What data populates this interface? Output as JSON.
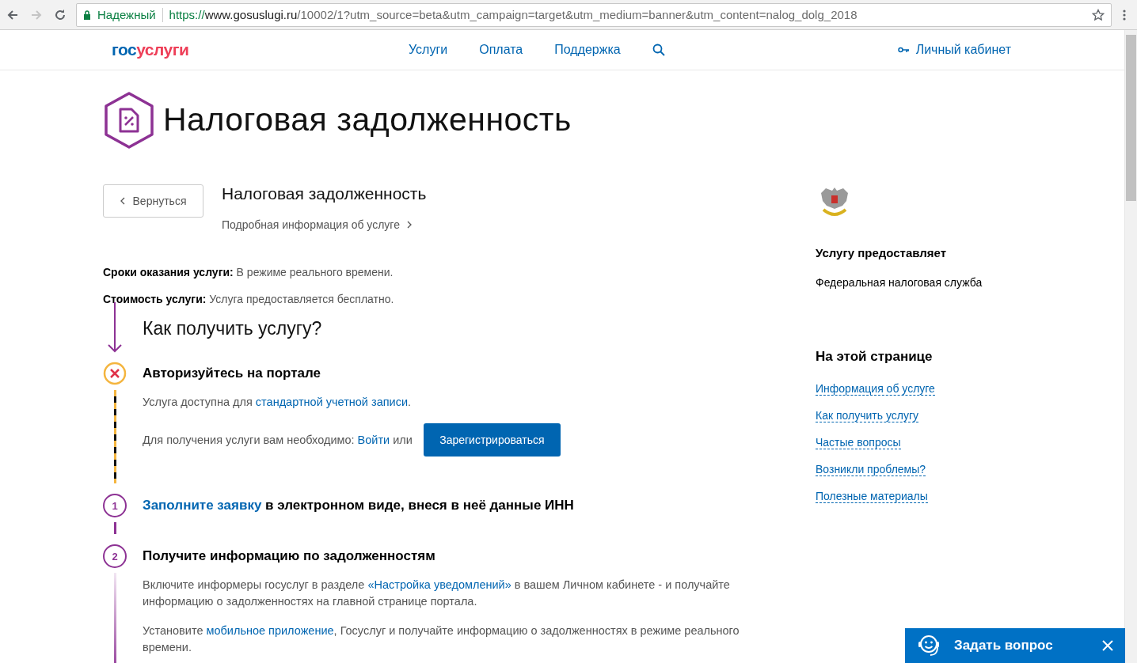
{
  "browser": {
    "security": "Надежный",
    "url": [
      {
        "kind": "scheme",
        "text": "https://"
      },
      {
        "kind": "host",
        "text": "www.gosuslugi.ru"
      },
      {
        "kind": "path",
        "text": "/10002/1?utm_source=beta&utm_campaign=target&utm_medium=banner&utm_content=nalog_dolg_2018"
      }
    ]
  },
  "header": {
    "logo": {
      "first": "гос",
      "second": "услуги"
    },
    "nav": [
      "Услуги",
      "Оплата",
      "Поддержка"
    ],
    "account": "Личный кабинет"
  },
  "page_title": "Налоговая задолженность",
  "back_button": "Вернуться",
  "service": {
    "title": "Налоговая задолженность",
    "details_link": "Подробная информация об услуге"
  },
  "facts": [
    {
      "label": "Сроки оказания услуги:",
      "value": "В режиме реального времени."
    },
    {
      "label": "Стоимость услуги:",
      "value": "Услуга предоставляется бесплатно."
    }
  ],
  "how_title": "Как получить услугу?",
  "steps": [
    {
      "kind": "error",
      "title": [
        {
          "kind": "text",
          "text": "Авторизуйтесь на портале"
        }
      ],
      "paragraphs": [
        [
          {
            "kind": "text",
            "text": "Услуга доступна для "
          },
          {
            "kind": "link",
            "text": "стандартной учетной записи"
          },
          {
            "kind": "text",
            "text": "."
          }
        ],
        [
          {
            "kind": "text",
            "text": "Для получения услуги вам необходимо: "
          },
          {
            "kind": "link",
            "text": "Войти"
          },
          {
            "kind": "text",
            "text": " или"
          }
        ]
      ],
      "button": "Зарегистрироваться"
    },
    {
      "kind": "number",
      "number": "1",
      "title": [
        {
          "kind": "link",
          "text": "Заполните заявку"
        },
        {
          "kind": "text",
          "text": " в электронном виде, внеся в неё данные ИНН"
        }
      ]
    },
    {
      "kind": "number",
      "number": "2",
      "title": [
        {
          "kind": "text",
          "text": "Получите информацию по задолженностям"
        }
      ],
      "paragraphs": [
        [
          {
            "kind": "text",
            "text": "Включите информеры госуслуг в разделе "
          },
          {
            "kind": "link",
            "text": "«Настройка уведомлений»"
          },
          {
            "kind": "text",
            "text": " в вашем Личном кабинете - и получайте информацию о задолженностях на главной странице портала."
          }
        ],
        [
          {
            "kind": "text",
            "text": "Установите "
          },
          {
            "kind": "link",
            "text": "мобильное приложение"
          },
          {
            "kind": "text",
            "text": ", Госуслуг и получайте информацию о задолженностях в режиме реального времени."
          }
        ]
      ]
    }
  ],
  "provider": {
    "heading": "Услугу предоставляет",
    "name": "Федеральная налоговая служба"
  },
  "on_page": {
    "heading": "На этой странице",
    "links": [
      "Информация об услуге",
      "Как получить услугу",
      "Частые вопросы",
      "Возникли проблемы?",
      "Полезные материалы"
    ]
  },
  "chat": {
    "label": "Задать вопрос"
  }
}
